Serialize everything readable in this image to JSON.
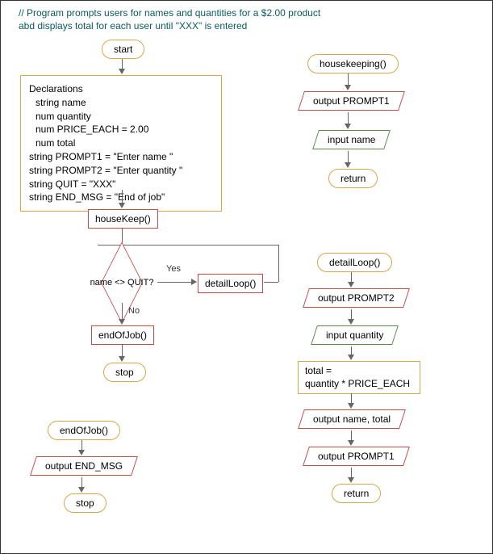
{
  "comment": {
    "line1": "// Program prompts users for names and quantities for a $2.00 product",
    "line2": "abd displays total for each user until \"XXX\" is entered"
  },
  "main": {
    "start": "start",
    "declarations": {
      "title": "Declarations",
      "l1": "string name",
      "l2": "num quantity",
      "l3": "num PRICE_EACH = 2.00",
      "l4": "num total",
      "l5": "string PROMPT1 = \"Enter name \"",
      "l6": "string PROMPT2 = \"Enter quantity \"",
      "l7": "string QUIT = \"XXX\"",
      "l8": "string END_MSG =  \"End of job\""
    },
    "housekeep_call": "houseKeep()",
    "decision_text": "name <> QUIT?",
    "yes": "Yes",
    "no": "No",
    "detailloop_call": "detailLoop()",
    "endofjob_call": "endOfJob()",
    "stop": "stop"
  },
  "endofjob_sub": {
    "name": "endOfJob()",
    "output": "output END_MSG",
    "stop": "stop"
  },
  "housekeeping_sub": {
    "name": "housekeeping()",
    "output1": "output PROMPT1",
    "input1": "input name",
    "return": "return"
  },
  "detailloop_sub": {
    "name": "detailLoop()",
    "output_p2": "output PROMPT2",
    "input_qty": "input quantity",
    "calc_l1": "total =",
    "calc_l2": "quantity * PRICE_EACH",
    "output_nt": "output name, total",
    "output_p1": "output PROMPT1",
    "return": "return"
  }
}
